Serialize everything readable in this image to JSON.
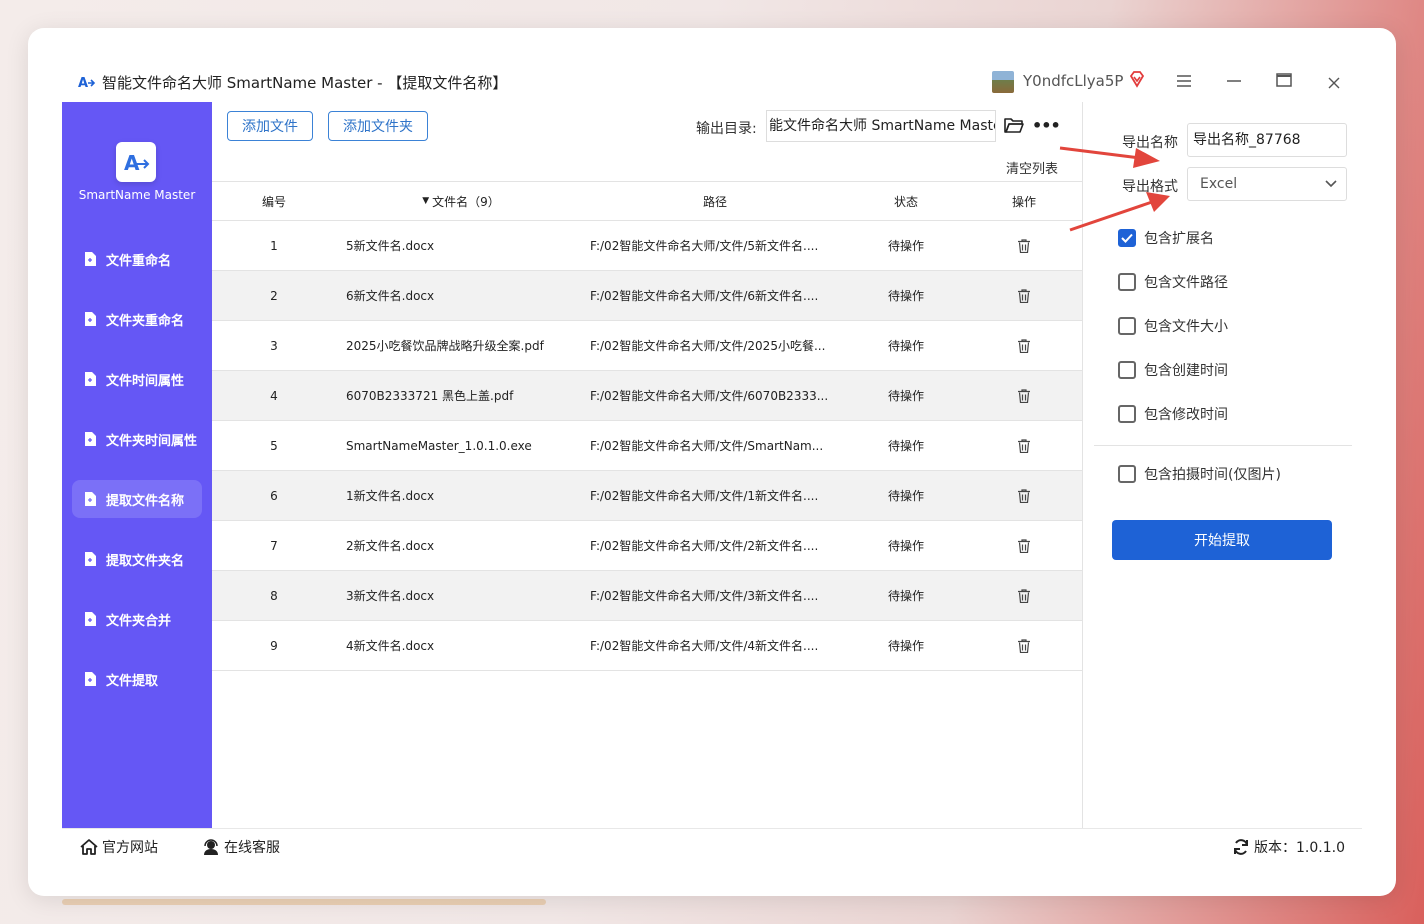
{
  "window": {
    "title": "智能文件命名大师 SmartName Master - 【提取文件名称】",
    "user_name": "Y0ndfcLlya5P"
  },
  "sidebar": {
    "logo_text": "SmartName Master",
    "items": [
      {
        "label": "文件重命名",
        "active": false
      },
      {
        "label": "文件夹重命名",
        "active": false
      },
      {
        "label": "文件时间属性",
        "active": false
      },
      {
        "label": "文件夹时间属性",
        "active": false
      },
      {
        "label": "提取文件名称",
        "active": true
      },
      {
        "label": "提取文件夹名",
        "active": false
      },
      {
        "label": "文件夹合并",
        "active": false
      },
      {
        "label": "文件提取",
        "active": false
      }
    ]
  },
  "toolbar": {
    "add_file_label": "添加文件",
    "add_folder_label": "添加文件夹",
    "output_dir_label": "输出目录:",
    "output_dir_value": "能文件命名大师 SmartName Master",
    "clear_list_label": "清空列表"
  },
  "table": {
    "headers": {
      "num": "编号",
      "name": "文件名（9）",
      "path": "路径",
      "status": "状态",
      "op": "操作"
    },
    "rows": [
      {
        "num": "1",
        "name": "5新文件名.docx",
        "path": "F:/02智能文件命名大师/文件/5新文件名....",
        "status": "待操作"
      },
      {
        "num": "2",
        "name": "6新文件名.docx",
        "path": "F:/02智能文件命名大师/文件/6新文件名....",
        "status": "待操作"
      },
      {
        "num": "3",
        "name": "2025小吃餐饮品牌战略升级全案.pdf",
        "path": "F:/02智能文件命名大师/文件/2025小吃餐...",
        "status": "待操作"
      },
      {
        "num": "4",
        "name": "6070B2333721 黑色上盖.pdf",
        "path": "F:/02智能文件命名大师/文件/6070B2333...",
        "status": "待操作"
      },
      {
        "num": "5",
        "name": "SmartNameMaster_1.0.1.0.exe",
        "path": "F:/02智能文件命名大师/文件/SmartNam...",
        "status": "待操作"
      },
      {
        "num": "6",
        "name": "1新文件名.docx",
        "path": "F:/02智能文件命名大师/文件/1新文件名....",
        "status": "待操作"
      },
      {
        "num": "7",
        "name": "2新文件名.docx",
        "path": "F:/02智能文件命名大师/文件/2新文件名....",
        "status": "待操作"
      },
      {
        "num": "8",
        "name": "3新文件名.docx",
        "path": "F:/02智能文件命名大师/文件/3新文件名....",
        "status": "待操作"
      },
      {
        "num": "9",
        "name": "4新文件名.docx",
        "path": "F:/02智能文件命名大师/文件/4新文件名....",
        "status": "待操作"
      }
    ]
  },
  "panel": {
    "export_name_label": "导出名称",
    "export_name_value": "导出名称_87768",
    "export_format_label": "导出格式",
    "export_format_value": "Excel",
    "options": [
      {
        "label": "包含扩展名",
        "checked": true
      },
      {
        "label": "包含文件路径",
        "checked": false
      },
      {
        "label": "包含文件大小",
        "checked": false
      },
      {
        "label": "包含创建时间",
        "checked": false
      },
      {
        "label": "包含修改时间",
        "checked": false
      }
    ],
    "photo_option": {
      "label": "包含拍摄时间(仅图片)",
      "checked": false
    },
    "start_label": "开始提取"
  },
  "footer": {
    "website_label": "官方网站",
    "support_label": "在线客服",
    "version_label": "版本：1.0.1.0"
  },
  "colors": {
    "sidebar": "#6557f5",
    "sidebar_active": "#7b70f7",
    "primary": "#1e62d6",
    "arrow": "#e2453c"
  }
}
